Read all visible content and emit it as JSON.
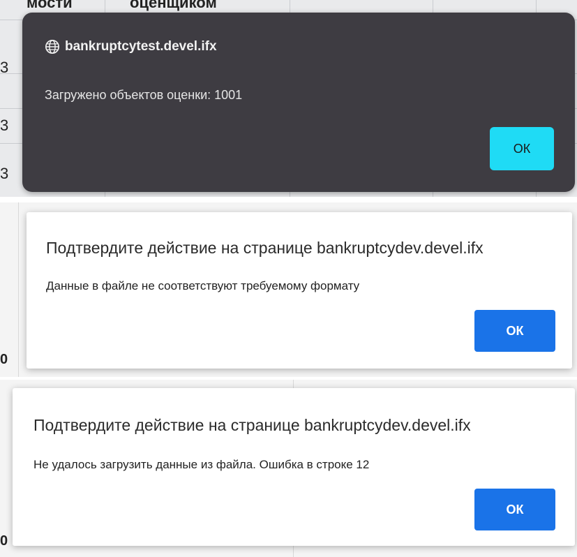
{
  "alert_dark": {
    "background_header_left": "мости",
    "background_header_right": "оценщиком",
    "background_row_glyph": "3",
    "host": "bankruptcytest.devel.ifx",
    "message": "Загружено объектов оценки: 1001",
    "ok_label": "ОК",
    "colors": {
      "dialog_bg": "#3e3c42",
      "ok_bg": "#1fdbf5"
    }
  },
  "confirm_format": {
    "title": "Подтвердите действие на странице bankruptcydev.devel.ifx",
    "message": "Данные в файле не соответствуют требуемому формату",
    "ok_label": "ОК",
    "edge_glyph": "0",
    "colors": {
      "ok_bg": "#1a73e8"
    }
  },
  "confirm_row_error": {
    "title": "Подтвердите действие на странице bankruptcydev.devel.ifx",
    "message": "Не удалось загрузить данные из файла. Ошибка в строке 12",
    "ok_label": "ОК",
    "edge_glyph": "0",
    "colors": {
      "ok_bg": "#1a73e8"
    }
  },
  "icons": {
    "host_icon": "globe-icon"
  }
}
